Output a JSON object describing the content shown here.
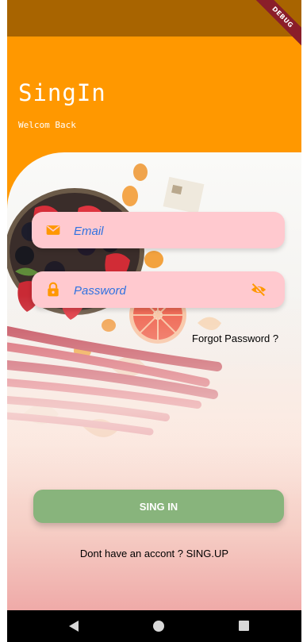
{
  "status_bar": {
    "debug_label": "DEBUG"
  },
  "header": {
    "title": "SingIn",
    "subtitle": "Welcom Back"
  },
  "form": {
    "email": {
      "placeholder": "Email",
      "icon": "envelope-icon"
    },
    "password": {
      "placeholder": "Password",
      "icon": "lock-icon",
      "toggle_icon": "eye-off-icon"
    },
    "forgot_label": "Forgot Password ?",
    "submit_label": "SING IN",
    "signup_label": "Dont have an accont ? SING.UP"
  },
  "colors": {
    "header": "#ff9800",
    "field": "#ffc9cf",
    "button": "#88b47c",
    "accent_icon": "#ff9800"
  },
  "navbar": {
    "icons": [
      "back-icon",
      "home-icon",
      "recents-icon"
    ]
  }
}
